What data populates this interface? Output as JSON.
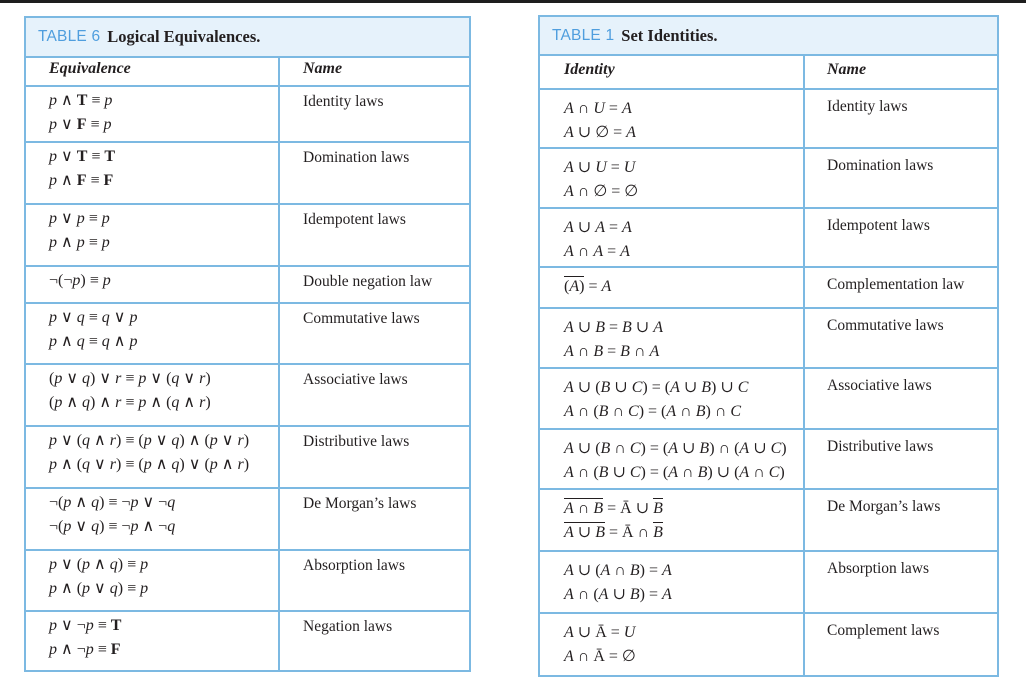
{
  "left_table": {
    "label": "TABLE 6",
    "title": "Logical Equivalences.",
    "col_headers": [
      "Equivalence",
      "Name"
    ],
    "rows": [
      {
        "lines": [
          "p ∧ T ≡ p",
          "p ∨ F ≡ p"
        ],
        "name": "Identity laws"
      },
      {
        "lines": [
          "p ∨ T ≡ T",
          "p ∧ F ≡ F"
        ],
        "name": "Domination laws"
      },
      {
        "lines": [
          "p ∨ p ≡ p",
          "p ∧ p ≡ p"
        ],
        "name": "Idempotent laws"
      },
      {
        "lines": [
          "¬(¬p) ≡ p"
        ],
        "name": "Double negation law"
      },
      {
        "lines": [
          "p ∨ q ≡ q ∨ p",
          "p ∧ q ≡ q ∧ p"
        ],
        "name": "Commutative laws"
      },
      {
        "lines": [
          "(p ∨ q) ∨ r ≡ p ∨ (q ∨ r)",
          "(p ∧ q) ∧ r ≡ p ∧ (q ∧ r)"
        ],
        "name": "Associative laws"
      },
      {
        "lines": [
          "p ∨ (q ∧ r) ≡ (p ∨ q) ∧ (p ∨ r)",
          "p ∧ (q ∨ r) ≡ (p ∧ q) ∨ (p ∧ r)"
        ],
        "name": "Distributive laws"
      },
      {
        "lines": [
          "¬(p ∧ q) ≡ ¬p ∨ ¬q",
          "¬(p ∨ q) ≡ ¬p ∧ ¬q"
        ],
        "name": "De Morgan’s laws"
      },
      {
        "lines": [
          "p ∨ (p ∧ q) ≡ p",
          "p ∧ (p ∨ q) ≡ p"
        ],
        "name": "Absorption laws"
      },
      {
        "lines": [
          "p ∨ ¬p ≡ T",
          "p ∧ ¬p ≡ F"
        ],
        "name": "Negation laws"
      }
    ]
  },
  "right_table": {
    "label": "TABLE 1",
    "title": "Set Identities.",
    "col_headers": [
      "Identity",
      "Name"
    ],
    "rows": [
      {
        "lines": [
          "A ∩ U = A",
          "A ∪ ∅ = A"
        ],
        "name": "Identity laws"
      },
      {
        "lines": [
          "A ∪ U = U",
          "A ∩ ∅ = ∅"
        ],
        "name": "Domination laws"
      },
      {
        "lines": [
          "A ∪ A = A",
          "A ∩ A = A"
        ],
        "name": "Idempotent laws"
      },
      {
        "lines": [
          "(Ā)‾ = A"
        ],
        "name": "Complementation law"
      },
      {
        "lines": [
          "A ∪ B = B ∪ A",
          "A ∩ B = B ∩ A"
        ],
        "name": "Commutative laws"
      },
      {
        "lines": [
          "A ∪ (B ∪ C) = (A ∪ B) ∪ C",
          "A ∩ (B ∩ C) = (A ∩ B) ∩ C"
        ],
        "name": "Associative laws"
      },
      {
        "lines": [
          "A ∪ (B ∩ C) = (A ∪ B) ∩ (A ∪ C)",
          "A ∩ (B ∪ C) = (A ∩ B) ∪ (A ∩ C)"
        ],
        "name": "Distributive laws"
      },
      {
        "lines": [
          "(A ∩ B)‾ = Ā ∪ B̄",
          "(A ∪ B)‾ = Ā ∩ B̄"
        ],
        "name": "De Morgan’s laws"
      },
      {
        "lines": [
          "A ∪ (A ∩ B) = A",
          "A ∩ (A ∪ B) = A"
        ],
        "name": "Absorption laws"
      },
      {
        "lines": [
          "A ∪ Ā = U",
          "A ∩ Ā = ∅"
        ],
        "name": "Complement laws"
      }
    ]
  }
}
